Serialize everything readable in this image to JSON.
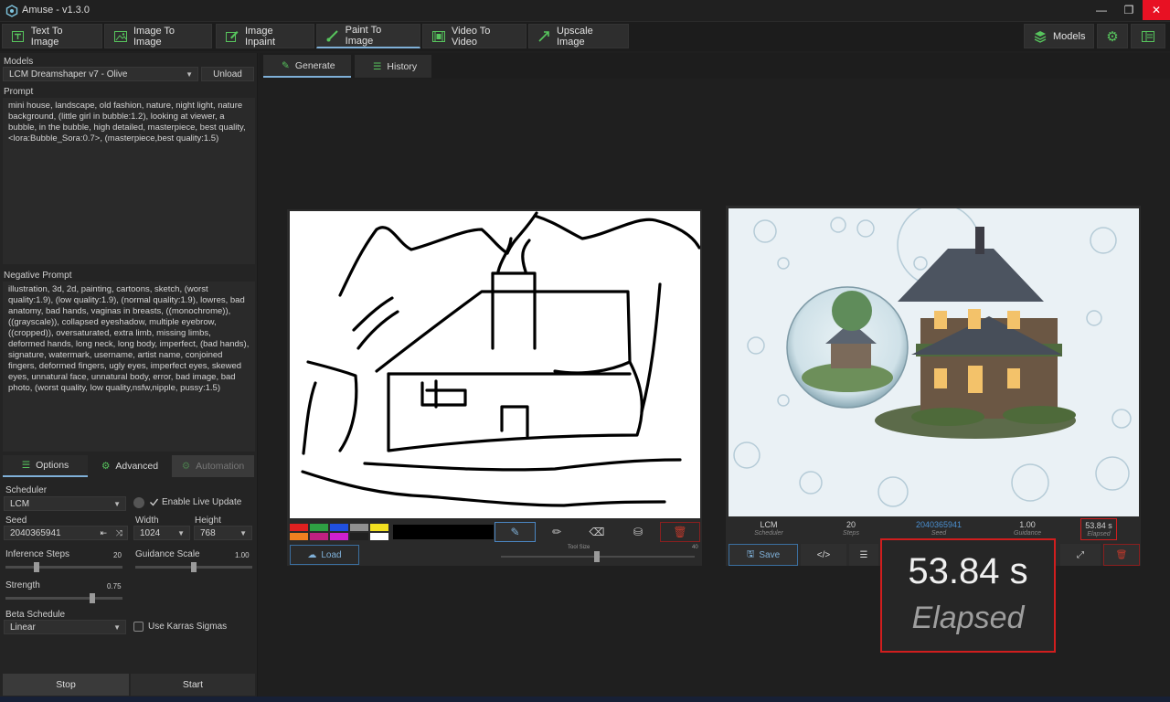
{
  "window": {
    "title": "Amuse - v1.3.0",
    "controls": {
      "minimize": "—",
      "maximize": "❐",
      "close": "✕"
    }
  },
  "main_tabs": [
    {
      "label": "Text To Image",
      "icon": "text-icon"
    },
    {
      "label": "Image To Image",
      "icon": "image-icon"
    },
    {
      "label": "Image Inpaint",
      "icon": "edit-icon"
    },
    {
      "label": "Paint To Image",
      "icon": "brush-icon",
      "active": true
    },
    {
      "label": "Video To Video",
      "icon": "film-icon"
    },
    {
      "label": "Upscale Image",
      "icon": "upscale-icon"
    }
  ],
  "toolbar": {
    "models_label": "Models"
  },
  "left": {
    "models_label": "Models",
    "model_value": "LCM Dreamshaper v7 - Olive",
    "unload_label": "Unload",
    "prompt_label": "Prompt",
    "prompt_text": "mini house, landscape, old fashion, nature, night light, nature background, (little girl in bubble:1.2), looking at viewer, a bubble, in the bubble, high detailed, masterpiece, best quality, <lora:Bubble_Sora:0.7>, (masterpiece,best quality:1.5)",
    "negative_label": "Negative Prompt",
    "negative_text": "illustration, 3d, 2d, painting, cartoons, sketch, (worst quality:1.9), (low quality:1.9), (normal quality:1.9), lowres, bad anatomy, bad hands, vaginas in breasts, ((monochrome)), ((grayscale)), collapsed eyeshadow, multiple eyebrow, ((cropped)), oversaturated, extra limb, missing limbs, deformed hands, long neck, long body, imperfect, (bad hands), signature, watermark, username, artist name, conjoined fingers, deformed fingers, ugly eyes, imperfect eyes, skewed eyes, unnatural face, unnatural body, error, bad image, bad photo, (worst quality, low quality,nsfw,nipple, pussy:1.5)",
    "subtabs": {
      "options": "Options",
      "advanced": "Advanced",
      "automation": "Automation"
    },
    "scheduler_label": "Scheduler",
    "scheduler_value": "LCM",
    "live_update_label": "Enable Live Update",
    "seed_label": "Seed",
    "seed_value": "2040365941",
    "width_label": "Width",
    "width_value": "1024",
    "height_label": "Height",
    "height_value": "768",
    "steps_label": "Inference Steps",
    "steps_value": "20",
    "steps_fraction": 0.25,
    "guidance_label": "Guidance Scale",
    "guidance_value": "1.00",
    "guidance_fraction": 0.5,
    "strength_label": "Strength",
    "strength_value": "0.75",
    "strength_fraction": 0.75,
    "beta_label": "Beta Schedule",
    "beta_value": "Linear",
    "karras_label": "Use Karras Sigmas",
    "stop_label": "Stop",
    "start_label": "Start"
  },
  "right_tabs": {
    "generate": "Generate",
    "history": "History"
  },
  "canvas": {
    "palette": [
      "#e02020",
      "#2ea043",
      "#2050e0",
      "#909090",
      "#f2e020",
      "#f08020",
      "#c02080",
      "#d020d0",
      "#202020",
      "#ffffff"
    ],
    "load_label": "Load",
    "size_label": "Tool Size",
    "size_max": "40"
  },
  "result": {
    "stats": [
      {
        "value": "LCM",
        "label": "Scheduler"
      },
      {
        "value": "20",
        "label": "Steps"
      },
      {
        "value": "2040365941",
        "label": "Seed"
      },
      {
        "value": "1.00",
        "label": "Guidance"
      },
      {
        "value": "53.84 s",
        "label": "Elapsed"
      }
    ],
    "save_label": "Save"
  },
  "callout": {
    "value": "53.84 s",
    "label": "Elapsed"
  }
}
